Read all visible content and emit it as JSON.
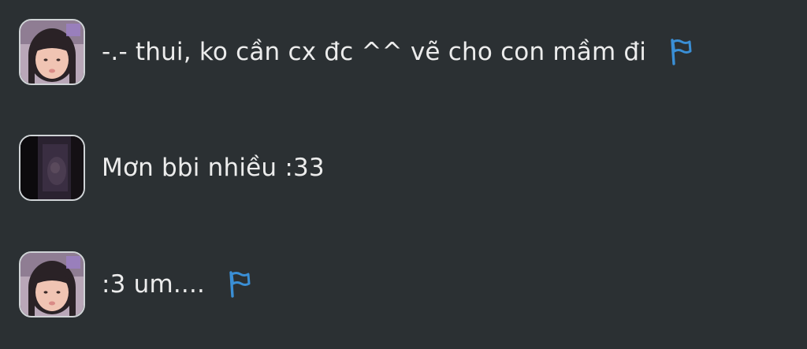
{
  "messages": [
    {
      "text": "-.- thui, ko cần cx đc ^^ vẽ cho con mầm đi",
      "avatar": "girl-portrait-avatar",
      "has_flag": true
    },
    {
      "text": "Mơn bbi nhiều :33",
      "avatar": "dark-room-avatar",
      "has_flag": false
    },
    {
      "text": ":3 um....",
      "avatar": "girl-portrait-avatar",
      "has_flag": true
    }
  ],
  "colors": {
    "background": "#2b3033",
    "text": "#ececec",
    "flag": "#3a8fd6",
    "avatar_border": "#cfd3d6"
  },
  "icons": {
    "flag": "flag-icon"
  }
}
